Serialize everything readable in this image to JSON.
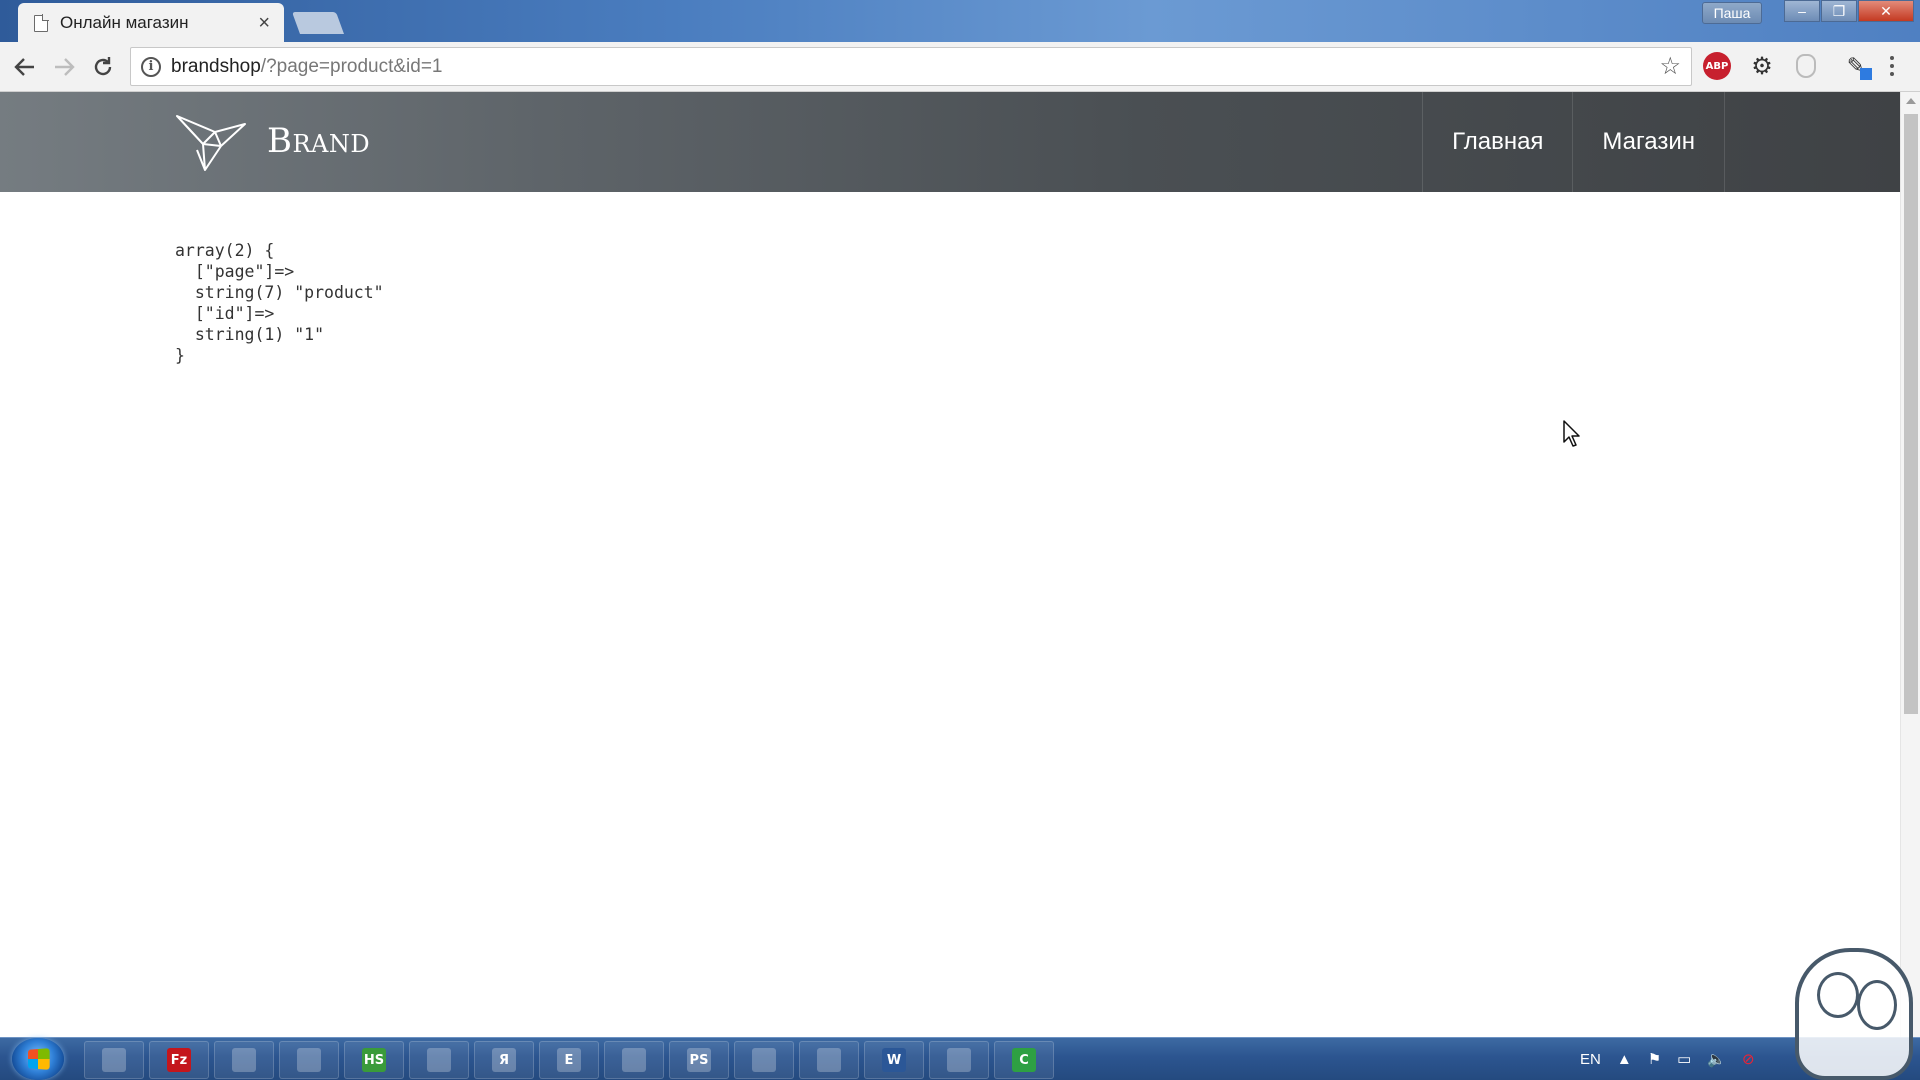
{
  "browser": {
    "tab": {
      "title": "Онлайн магазин"
    },
    "profile": "Паша",
    "url": {
      "host": "brandshop",
      "path": "/?page=product&id=1"
    },
    "extensions": {
      "adblock": "ABP"
    }
  },
  "site": {
    "brand": "Brand",
    "nav": [
      {
        "label": "Главная"
      },
      {
        "label": "Магазин"
      }
    ]
  },
  "dump": {
    "lines": [
      "array(2) {",
      "  [\"page\"]=>",
      "  string(7) \"product\"",
      "  [\"id\"]=>",
      "  string(1) \"1\"",
      "}"
    ]
  },
  "taskbar": {
    "apps": [
      {
        "icon": "files-app-icon",
        "label": ""
      },
      {
        "icon": "filezilla-icon",
        "label": "Fz",
        "color": "#c4161c"
      },
      {
        "icon": "notepad-icon",
        "label": ""
      },
      {
        "icon": "explorer-icon",
        "label": ""
      },
      {
        "icon": "hs-app-icon",
        "label": "HS",
        "color": "#3a9b3a"
      },
      {
        "icon": "save-icon",
        "label": ""
      },
      {
        "icon": "font-app-icon",
        "label": "Я"
      },
      {
        "icon": "terminal-icon",
        "label": "E"
      },
      {
        "icon": "firefox-icon",
        "label": ""
      },
      {
        "icon": "phpstorm-icon",
        "label": "PS"
      },
      {
        "icon": "chrome-icon",
        "label": ""
      },
      {
        "icon": "presentation-icon",
        "label": ""
      },
      {
        "icon": "word-icon",
        "label": "W",
        "color": "#2b5797"
      },
      {
        "icon": "video-app-icon",
        "label": ""
      },
      {
        "icon": "camtasia-icon",
        "label": "C",
        "color": "#2ea043"
      }
    ],
    "tray": {
      "language": "EN"
    }
  }
}
